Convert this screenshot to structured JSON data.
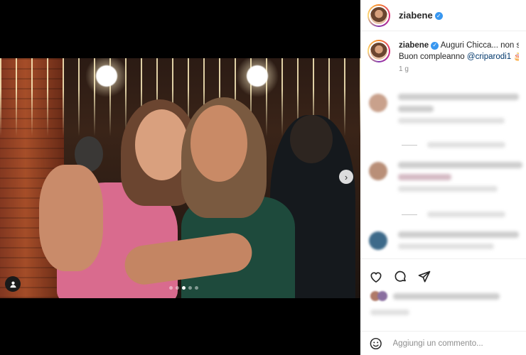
{
  "post": {
    "username": "ziabene",
    "caption_text": "Auguri Chicca... non sia",
    "caption_line2_prefix": "Buon compleanno",
    "mention": "@criparodi1",
    "caption_emoji": "🎂",
    "time_ago": "1 g"
  },
  "carousel": {
    "next_icon": "chevron-right-icon",
    "slide_count": 5,
    "active_slide": 3
  },
  "comment_box": {
    "placeholder": "Aggiungi un commento..."
  },
  "icons": {
    "verified": "verified-badge-icon",
    "like": "heart-icon",
    "comment": "comment-bubble-icon",
    "share": "paper-plane-icon",
    "emoji": "smiley-icon",
    "tag": "user-tag-icon"
  },
  "colors": {
    "verified_blue": "#3897f0",
    "mention": "#00376b",
    "muted": "#8e8e8e"
  }
}
